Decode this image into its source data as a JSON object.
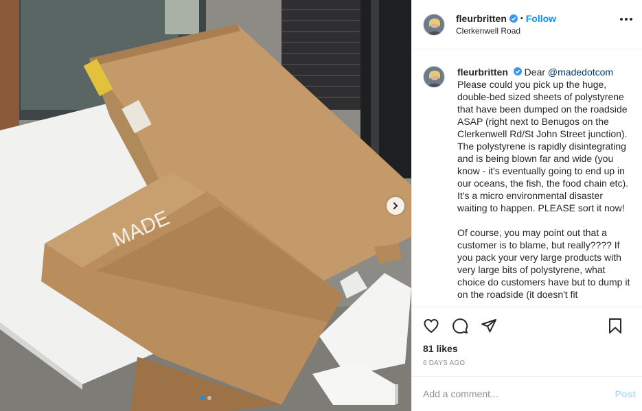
{
  "post": {
    "username": "fleurbritten",
    "location": "Clerkenwell Road",
    "follow_separator": "•",
    "follow_label": "Follow",
    "photo_label": "MADE",
    "carousel": {
      "slide_count": 2,
      "active_index": 0
    }
  },
  "caption": {
    "username": "fleurbritten",
    "greeting": "Dear",
    "mention": "@madedotcom",
    "paragraph1": "Please could you pick up the huge, double-bed sized sheets of polystyrene that have been dumped on the roadside ASAP (right next to Benugos on the Clerkenwell Rd/St John Street junction). The polystyrene is rapidly disintegrating and is being blown far and wide (you know - it's eventually going to end up in our oceans, the fish, the food chain etc). It's a micro environmental disaster waiting to happen. PLEASE sort it now!",
    "paragraph2": "Of course, you may point out that a customer is to blame, but really???? If you pack your very large products with very large bits of polystyrene, what choice do customers have but to dump it on the roadside (it doesn't fit"
  },
  "stats": {
    "likes": "81 likes",
    "date": "6 DAYS AGO"
  },
  "comment_box": {
    "placeholder": "Add a comment...",
    "post_label": "Post"
  },
  "icons": {
    "verified": "verified-badge-icon",
    "more": "more-options-icon",
    "like": "heart-icon",
    "comment": "comment-bubble-icon",
    "share": "paper-plane-icon",
    "save": "bookmark-icon",
    "next": "chevron-right-icon"
  },
  "colors": {
    "accent": "#0095f6",
    "mention": "#00376b",
    "muted": "#8e8e8e",
    "post_disabled": "#b2dffc"
  }
}
